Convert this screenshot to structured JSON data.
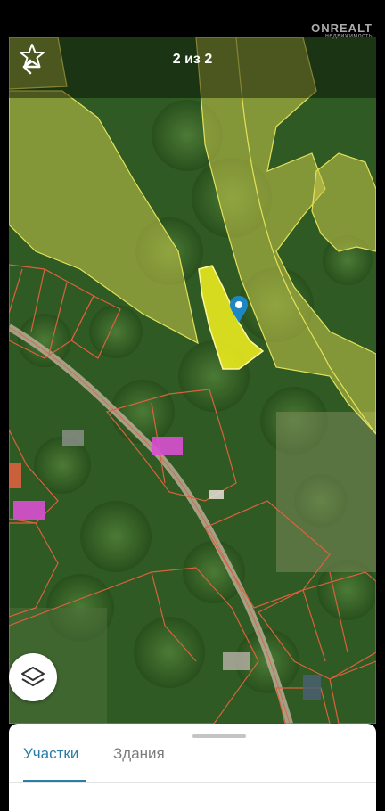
{
  "header": {
    "title": "2 из 2",
    "back_icon": "arrow-left-icon",
    "favorite_icon": "star-outline-icon"
  },
  "watermark": {
    "brand": "ONREALT",
    "tagline": "недвижимость"
  },
  "map": {
    "type": "satellite-cadastral",
    "selected_parcel_color": "#f4f21e",
    "parcel_border_color": "#d9623e",
    "marker_color": "#1f86c4",
    "building_color": "#d94fd3",
    "layers_icon": "layers-icon"
  },
  "bottom_sheet": {
    "tabs": [
      {
        "label": "Участки",
        "active": true
      },
      {
        "label": "Здания",
        "active": false
      }
    ],
    "accent": "#2a7da4"
  }
}
